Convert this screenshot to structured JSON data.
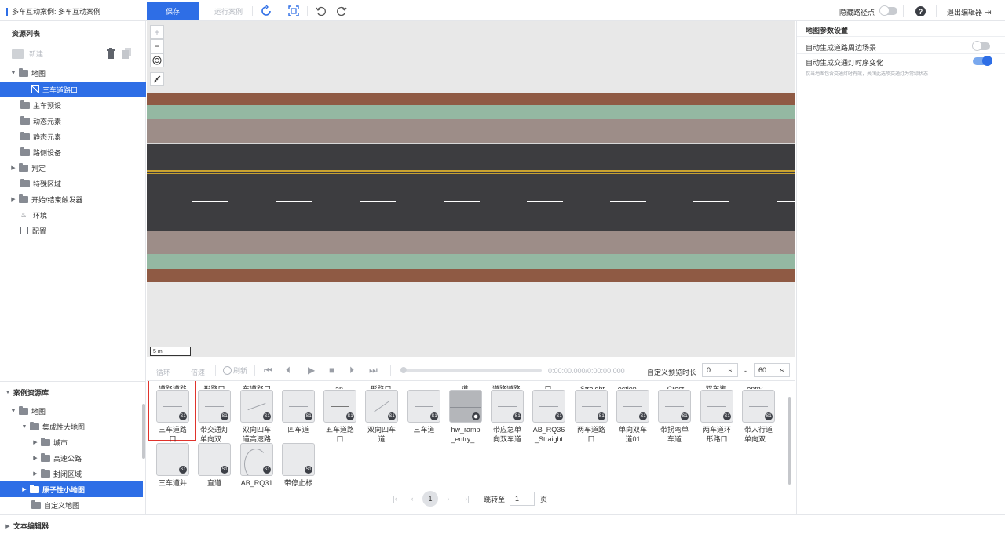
{
  "header": {
    "title": "多车互动案例: 多车互动案例",
    "save_label": "保存",
    "run_label": "运行案例",
    "hide_path_label": "隐藏路径点",
    "help_label": "?",
    "exit_label": "退出编辑器"
  },
  "resources": {
    "title": "资源列表",
    "new_label": "新建",
    "tree": [
      {
        "label": "地图",
        "caret": "▼",
        "open": true
      },
      {
        "label": "三车道路口",
        "selected": true
      },
      {
        "label": "主车预设"
      },
      {
        "label": "动态元素"
      },
      {
        "label": "静态元素"
      },
      {
        "label": "路侧设备"
      },
      {
        "label": "判定",
        "caret": "▶"
      },
      {
        "label": "特殊区域"
      },
      {
        "label": "开始/结束触发器",
        "caret": "▶"
      },
      {
        "label": "环境"
      },
      {
        "label": "配置"
      }
    ]
  },
  "map": {
    "scale_label": "5 m",
    "zoom_in": "+",
    "zoom_out": "−"
  },
  "playback": {
    "loop_label": "循环",
    "speed_label": "倍速",
    "refresh_label": "刷新",
    "time_display": "0:00:00.000/0:00:00.000",
    "preview_label": "自定义预览时长",
    "start_value": "0",
    "start_unit": "s",
    "range_sep": "-",
    "end_value": "60",
    "end_unit": "s"
  },
  "case_library": {
    "title": "案例资源库",
    "tree": [
      {
        "label": "地图",
        "caret": "▼"
      },
      {
        "label": "集成性大地图",
        "caret": "▼"
      },
      {
        "label": "城市",
        "caret": "▶"
      },
      {
        "label": "高速公路",
        "caret": "▶"
      },
      {
        "label": "封闭区域",
        "caret": "▶"
      },
      {
        "label": "原子性小地图",
        "caret": "▶",
        "selected": true
      },
      {
        "label": "自定义地图"
      }
    ]
  },
  "grid": {
    "cut_labels": [
      "道路道路",
      "形路口",
      "车道路口",
      "an",
      "形路口",
      "道",
      "道路道路",
      "口",
      "_Straight",
      "ection_...",
      "_Crest",
      "双车道",
      "_entry_..."
    ],
    "row1": [
      {
        "line1": "三车道路",
        "line2": "口"
      },
      {
        "line1": "带交通灯",
        "line2": "单向双…"
      },
      {
        "line1": "双向四车",
        "line2": "道高速路"
      },
      {
        "line1": "四车道",
        "line2": ""
      },
      {
        "line1": "五车道路",
        "line2": "口"
      },
      {
        "line1": "双向四车",
        "line2": "道"
      },
      {
        "line1": "三车道",
        "line2": ""
      },
      {
        "line1": "hw_ramp",
        "line2": "_entry_..."
      },
      {
        "line1": "带应急单",
        "line2": "向双车道"
      },
      {
        "line1": "AB_RQ36",
        "line2": "_Straight"
      },
      {
        "line1": "两车道路",
        "line2": "口"
      },
      {
        "line1": "单向双车",
        "line2": "道01"
      },
      {
        "line1": "带拐弯单",
        "line2": "车道"
      },
      {
        "line1": "两车道环",
        "line2": "形路口"
      },
      {
        "line1": "带人行道",
        "line2": "单向双…"
      }
    ],
    "row2": [
      {
        "line1": "三车道并",
        "line2": ""
      },
      {
        "line1": "直道",
        "line2": ""
      },
      {
        "line1": "AB_RQ31",
        "line2": ""
      },
      {
        "line1": "带停止标",
        "line2": ""
      }
    ],
    "badge": "S1"
  },
  "pager": {
    "current": "1",
    "jump_label": "跳转至",
    "jump_value": "1",
    "page_unit": "页"
  },
  "settings": {
    "title": "地图参数设置",
    "auto_scene_label": "自动生成道路周边场景",
    "auto_light_label": "自动生成交通灯时序变化",
    "auto_light_hint": "仅当地图包含交通灯时有效，关闭此选项交通灯为常绿状态"
  },
  "footer": {
    "text_editor_label": "文本编辑器"
  }
}
